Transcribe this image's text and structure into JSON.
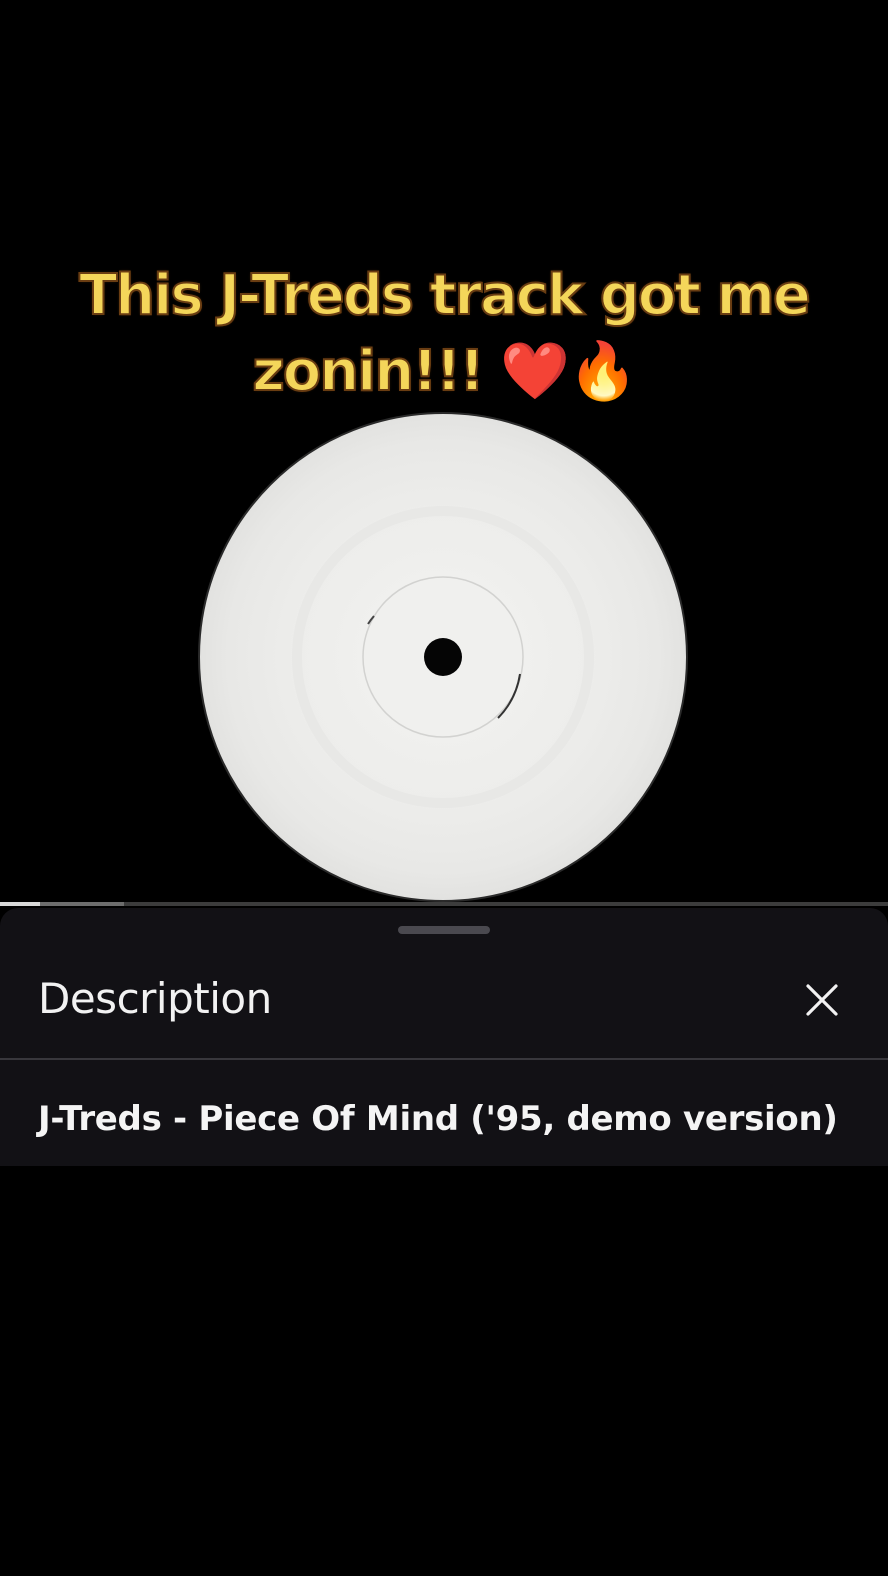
{
  "video": {
    "caption_text": "This J-Treds track got me zonin!!!",
    "caption_emojis": "❤️🔥",
    "caption_color": "#f4d65a",
    "media_icon": "white-label-vinyl-record",
    "progress_fraction": 0.045,
    "buffered_fraction": 0.14
  },
  "sheet": {
    "title": "Description",
    "close_icon": "close-icon",
    "description": "J-Treds - Piece Of Mind ('95, demo version)"
  }
}
